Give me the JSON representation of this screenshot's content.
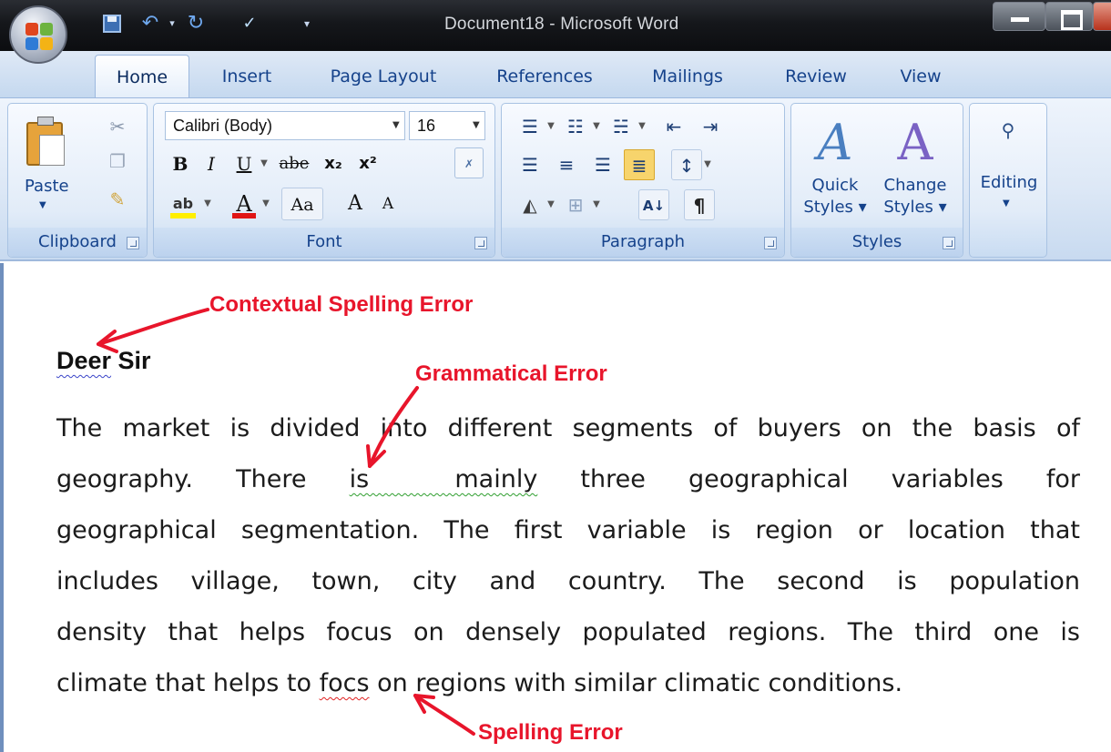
{
  "window": {
    "title": "Document18 - Microsoft Word"
  },
  "quick_access": {
    "icons": [
      "save-icon",
      "undo-icon",
      "redo-icon",
      "spelling-icon",
      "customize-icon"
    ]
  },
  "tabs": [
    "Home",
    "Insert",
    "Page Layout",
    "References",
    "Mailings",
    "Review",
    "View"
  ],
  "ribbon": {
    "clipboard": {
      "label": "Clipboard",
      "paste_label": "Paste"
    },
    "font": {
      "label": "Font",
      "font_name": "Calibri (Body)",
      "font_size": "16",
      "bold": "B",
      "italic": "I",
      "underline": "U",
      "strikethrough": "abe",
      "subscript": "x₂",
      "superscript": "x²",
      "highlight": "ab",
      "font_color": "A",
      "change_case": "Aa",
      "grow": "A",
      "shrink": "A"
    },
    "paragraph": {
      "label": "Paragraph",
      "sort": "A↓",
      "pilcrow": "¶"
    },
    "styles": {
      "label": "Styles",
      "quick_styles_line1": "Quick",
      "quick_styles_line2": "Styles ▾",
      "change_styles_line1": "Change",
      "change_styles_line2": "Styles ▾"
    },
    "editing": {
      "label": "Editing"
    }
  },
  "document": {
    "greeting": {
      "error_word": "Deer",
      "rest": " Sir"
    },
    "lines": [
      "The market is divided into different segments of buyers on the basis of",
      "geography. There is  mainly three geographical variables for",
      "geographical segmentation. The first variable is region or location that",
      "includes village, town, city and country. The second is population",
      "density that helps focus on densely populated regions. The third one is",
      "climate that helps to focs on regions with similar climatic conditions."
    ],
    "line2_parts": {
      "before": "geography.",
      "there": "There",
      "error": "is  mainly",
      "three": "three",
      "geographical": "geographical",
      "variables": "variables",
      "for": "for"
    },
    "line6_parts": {
      "before": "climate that helps to ",
      "error": "focs",
      "after": " on regions with similar climatic conditions."
    }
  },
  "annotations": {
    "contextual": "Contextual Spelling Error",
    "grammatical": "Grammatical Error",
    "spelling": "Spelling Error",
    "color": "#e8152b"
  },
  "colors": {
    "ribbon_text": "#15428b",
    "blue_squiggle": "#3a44c8",
    "green_squiggle": "#2f9e2f",
    "red_squiggle": "#e02020",
    "highlight_yellow": "#ffef00",
    "font_color_red": "#e01515"
  }
}
